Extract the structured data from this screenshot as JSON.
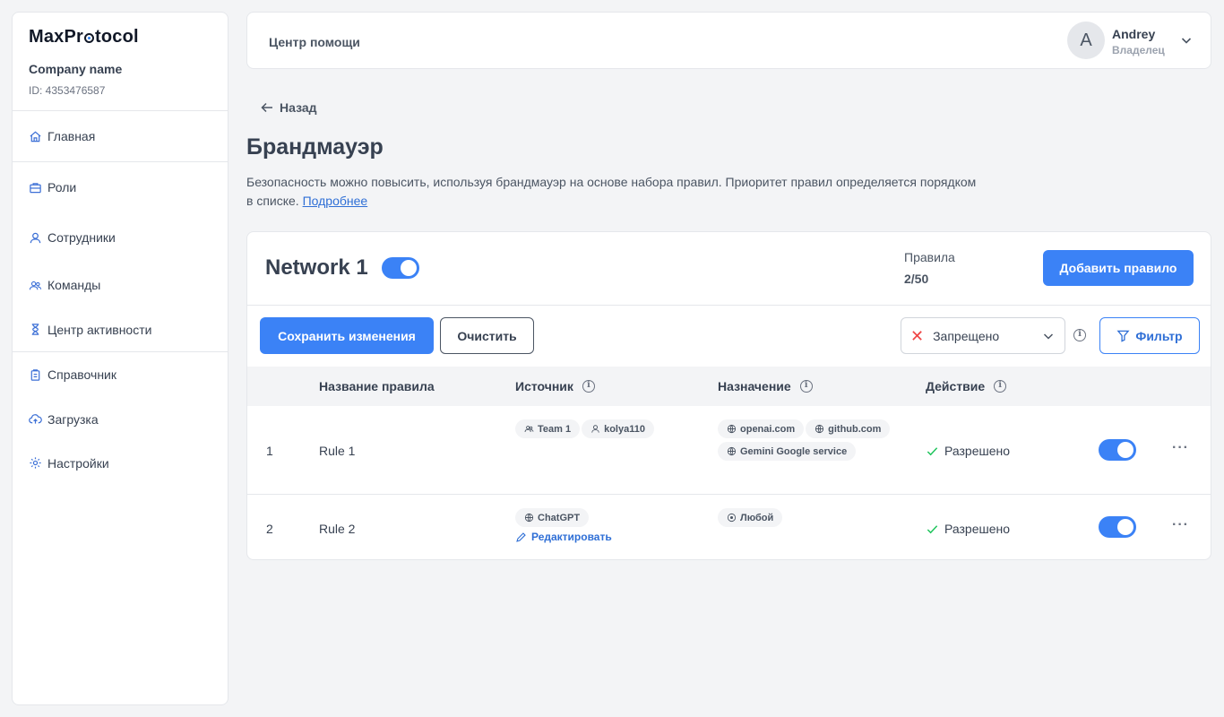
{
  "sidebar": {
    "logo_part1": "MaxPr",
    "logo_part2": "tocol",
    "company_name": "Company name",
    "company_id": "ID: 4353476587",
    "items": [
      {
        "label": "Главная",
        "icon": "home-icon"
      },
      {
        "label": "Роли",
        "icon": "briefcase-icon"
      },
      {
        "label": "Сотрудники",
        "icon": "user-icon"
      },
      {
        "label": "Команды",
        "icon": "users-icon"
      },
      {
        "label": "Центр активности",
        "icon": "hourglass-icon"
      },
      {
        "label": "Справочник",
        "icon": "clipboard-icon"
      },
      {
        "label": "Загрузка",
        "icon": "cloud-upload-icon"
      },
      {
        "label": "Настройки",
        "icon": "gear-icon"
      }
    ]
  },
  "header": {
    "title": "Центр помощи",
    "user_initial": "A",
    "user_name": "Andrey",
    "user_role": "Владелец"
  },
  "page": {
    "back_label": "Назад",
    "title": "Брандмауэр",
    "description": "Безопасность можно повысить, используя брандмауэр на основе набора правил. Приоритет правил определяется порядком в списке.",
    "more_link": "Подробнее"
  },
  "network": {
    "name": "Network 1",
    "enabled": true,
    "rules_label": "Правила",
    "rules_count": "2/50",
    "add_rule_label": "Добавить правило",
    "save_label": "Сохранить изменения",
    "clear_label": "Очистить",
    "action_filter_value": "Запрещено",
    "filter_label": "Фильтр"
  },
  "table": {
    "headers": {
      "name": "Название правила",
      "source": "Источник",
      "destination": "Назначение",
      "action": "Действие"
    },
    "rows": [
      {
        "num": "1",
        "name": "Rule 1",
        "sources": [
          "Team 1",
          "kolya110"
        ],
        "destinations": [
          "openai.com",
          "github.com",
          "Gemini Google service"
        ],
        "action": "Разрешено",
        "enabled": true
      },
      {
        "num": "2",
        "name": "Rule 2",
        "sources": [
          "ChatGPT"
        ],
        "edit_label": "Редактировать",
        "destinations": [
          "Любой"
        ],
        "action": "Разрешено",
        "enabled": true
      }
    ]
  },
  "colors": {
    "accent": "#3b82f6",
    "danger": "#ef4444",
    "success": "#22c55e"
  }
}
